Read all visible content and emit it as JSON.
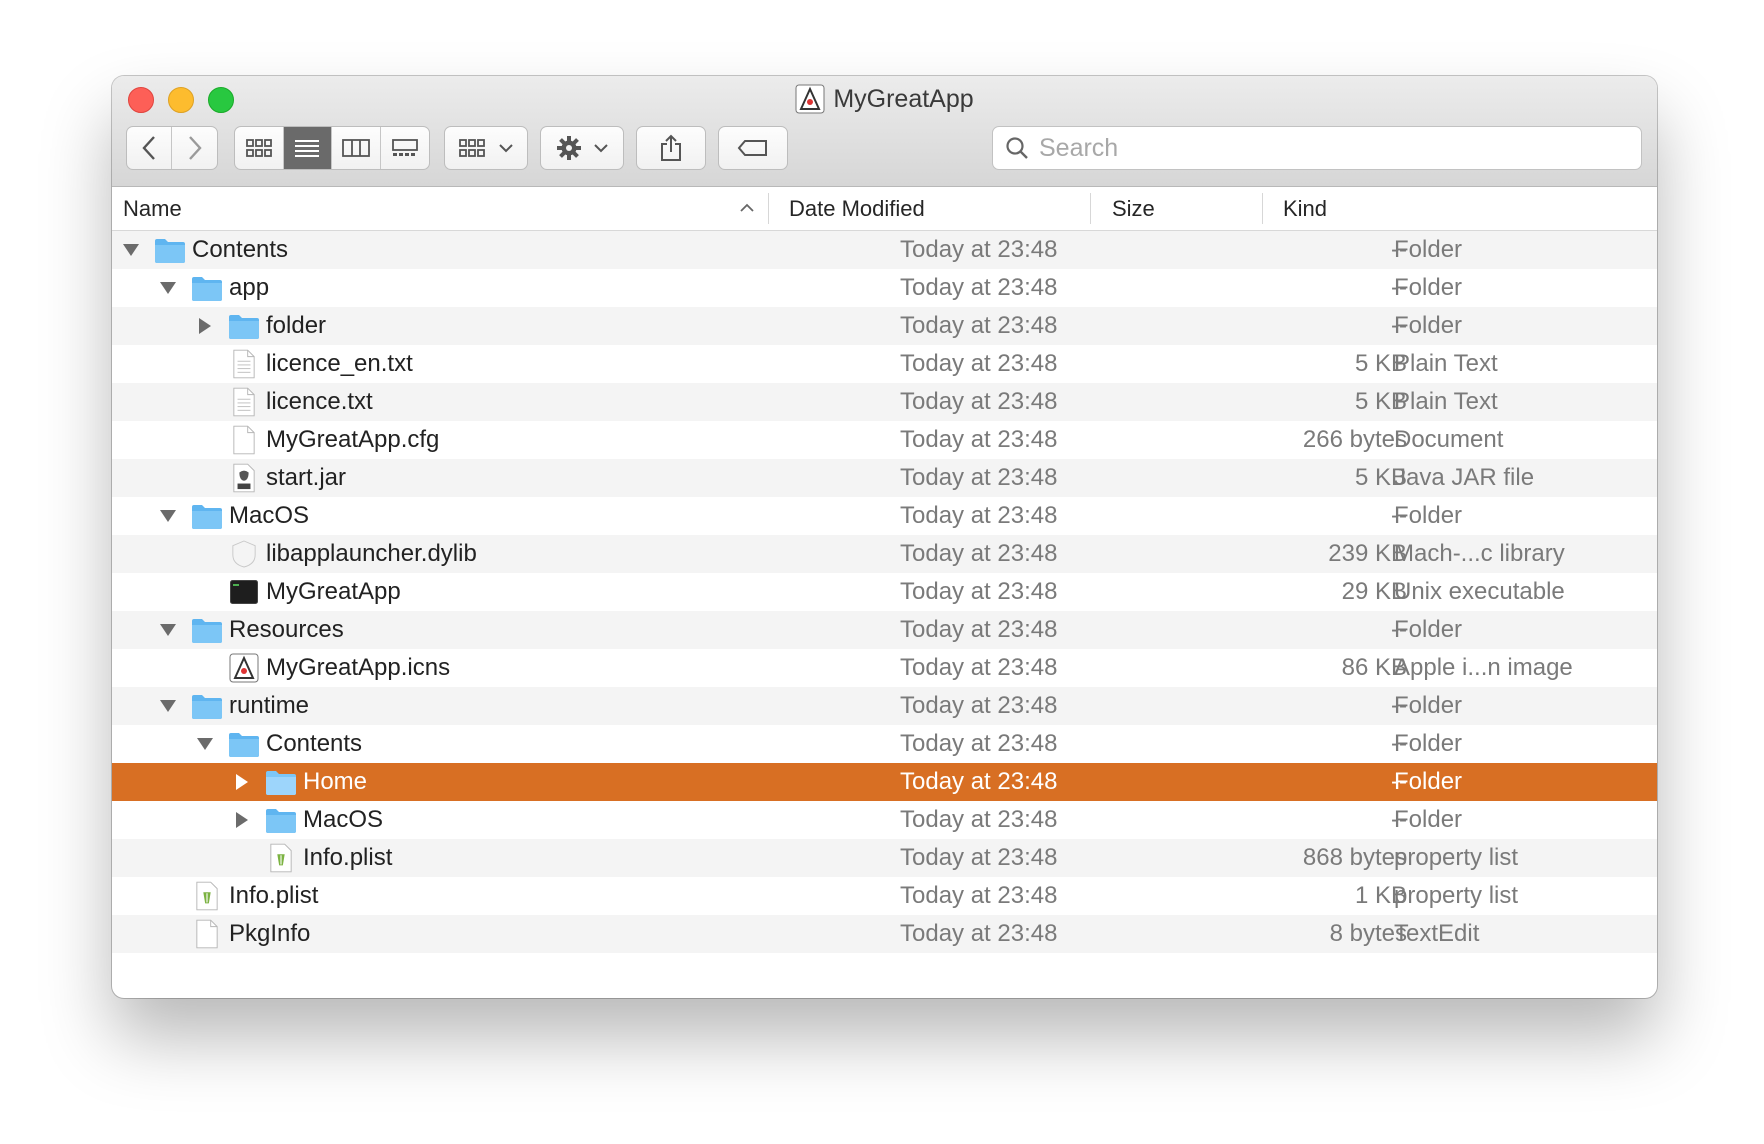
{
  "window": {
    "title": "MyGreatApp"
  },
  "toolbar": {
    "search_placeholder": "Search"
  },
  "columns": {
    "name": "Name",
    "date": "Date Modified",
    "size": "Size",
    "kind": "Kind"
  },
  "colors": {
    "selection": "#d86f23",
    "folder": "#5fb5f0"
  },
  "rows": [
    {
      "name": "Contents",
      "date": "Today at 23:48",
      "size": "--",
      "kind": "Folder",
      "depth": 0,
      "disclosure": "open",
      "icon": "folder-icon"
    },
    {
      "name": "app",
      "date": "Today at 23:48",
      "size": "--",
      "kind": "Folder",
      "depth": 1,
      "disclosure": "open",
      "icon": "folder-icon"
    },
    {
      "name": "folder",
      "date": "Today at 23:48",
      "size": "--",
      "kind": "Folder",
      "depth": 2,
      "disclosure": "closed",
      "icon": "folder-icon"
    },
    {
      "name": "licence_en.txt",
      "date": "Today at 23:48",
      "size": "5 KB",
      "kind": "Plain Text",
      "depth": 2,
      "disclosure": "none",
      "icon": "text-file-icon"
    },
    {
      "name": "licence.txt",
      "date": "Today at 23:48",
      "size": "5 KB",
      "kind": "Plain Text",
      "depth": 2,
      "disclosure": "none",
      "icon": "text-file-icon"
    },
    {
      "name": "MyGreatApp.cfg",
      "date": "Today at 23:48",
      "size": "266 bytes",
      "kind": "Document",
      "depth": 2,
      "disclosure": "none",
      "icon": "blank-file-icon"
    },
    {
      "name": "start.jar",
      "date": "Today at 23:48",
      "size": "5 KB",
      "kind": "Java JAR file",
      "depth": 2,
      "disclosure": "none",
      "icon": "jar-file-icon"
    },
    {
      "name": "MacOS",
      "date": "Today at 23:48",
      "size": "--",
      "kind": "Folder",
      "depth": 1,
      "disclosure": "open",
      "icon": "folder-icon"
    },
    {
      "name": "libapplauncher.dylib",
      "date": "Today at 23:48",
      "size": "239 KB",
      "kind": "Mach-...c library",
      "depth": 2,
      "disclosure": "none",
      "icon": "library-file-icon"
    },
    {
      "name": "MyGreatApp",
      "date": "Today at 23:48",
      "size": "29 KB",
      "kind": "Unix executable",
      "depth": 2,
      "disclosure": "none",
      "icon": "terminal-exec-icon"
    },
    {
      "name": "Resources",
      "date": "Today at 23:48",
      "size": "--",
      "kind": "Folder",
      "depth": 1,
      "disclosure": "open",
      "icon": "folder-icon"
    },
    {
      "name": "MyGreatApp.icns",
      "date": "Today at 23:48",
      "size": "86 KB",
      "kind": "Apple i...n image",
      "depth": 2,
      "disclosure": "none",
      "icon": "java-app-icon"
    },
    {
      "name": "runtime",
      "date": "Today at 23:48",
      "size": "--",
      "kind": "Folder",
      "depth": 1,
      "disclosure": "open",
      "icon": "folder-icon"
    },
    {
      "name": "Contents",
      "date": "Today at 23:48",
      "size": "--",
      "kind": "Folder",
      "depth": 2,
      "disclosure": "open",
      "icon": "folder-icon"
    },
    {
      "name": "Home",
      "date": "Today at 23:48",
      "size": "--",
      "kind": "Folder",
      "depth": 3,
      "disclosure": "closed",
      "icon": "folder-icon",
      "selected": true
    },
    {
      "name": "MacOS",
      "date": "Today at 23:48",
      "size": "--",
      "kind": "Folder",
      "depth": 3,
      "disclosure": "closed",
      "icon": "folder-icon"
    },
    {
      "name": "Info.plist",
      "date": "Today at 23:48",
      "size": "868 bytes",
      "kind": "property list",
      "depth": 3,
      "disclosure": "none",
      "icon": "plist-file-icon"
    },
    {
      "name": "Info.plist",
      "date": "Today at 23:48",
      "size": "1 KB",
      "kind": "property list",
      "depth": 1,
      "disclosure": "none",
      "icon": "plist-file-icon"
    },
    {
      "name": "PkgInfo",
      "date": "Today at 23:48",
      "size": "8 bytes",
      "kind": "TextEdit",
      "depth": 1,
      "disclosure": "none",
      "icon": "blank-file-icon"
    }
  ]
}
